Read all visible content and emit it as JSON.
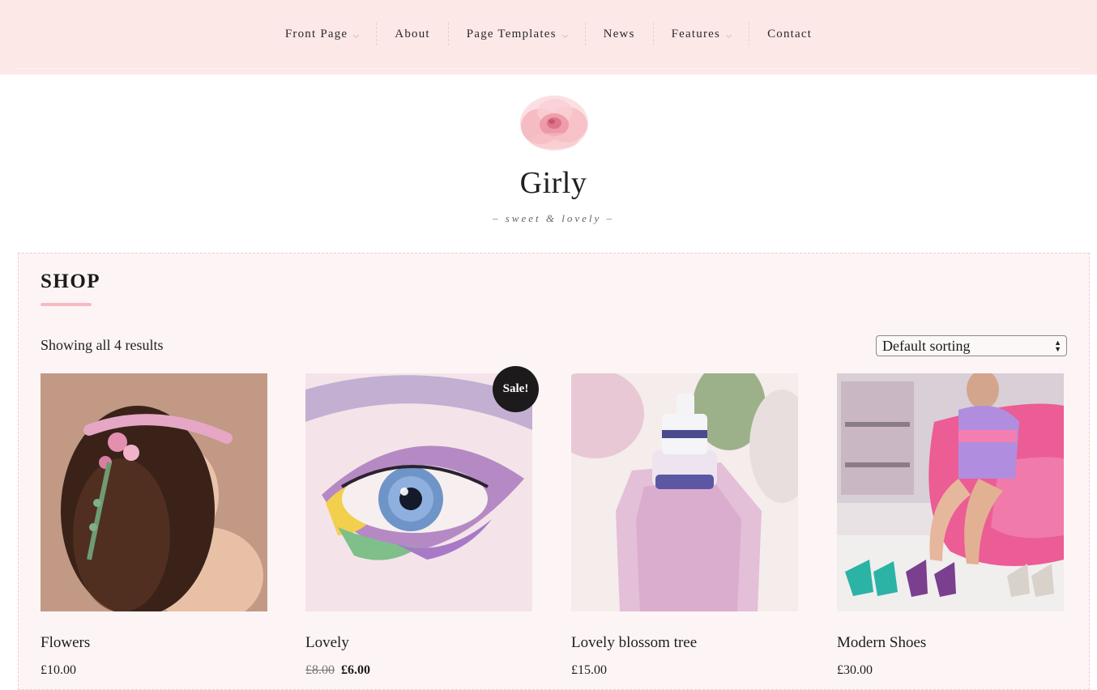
{
  "nav": {
    "items": [
      {
        "label": "Front Page",
        "has_submenu": true
      },
      {
        "label": "About",
        "has_submenu": false
      },
      {
        "label": "Page Templates",
        "has_submenu": true
      },
      {
        "label": "News",
        "has_submenu": false
      },
      {
        "label": "Features",
        "has_submenu": true
      },
      {
        "label": "Contact",
        "has_submenu": false
      }
    ]
  },
  "header": {
    "logo_icon": "rose-logo-icon",
    "title": "Girly",
    "tagline": "– sweet & lovely –"
  },
  "shop": {
    "title": "SHOP",
    "result_count": "Showing all 4 results",
    "sort": {
      "selected": "Default sorting"
    },
    "products": [
      {
        "name": "Flowers",
        "price": "£10.00",
        "on_sale": false
      },
      {
        "name": "Lovely",
        "regular_price": "£8.00",
        "sale_price": "£6.00",
        "on_sale": true,
        "badge": "Sale!"
      },
      {
        "name": "Lovely blossom tree",
        "price": "£15.00",
        "on_sale": false
      },
      {
        "name": "Modern Shoes",
        "price": "£30.00",
        "on_sale": false
      }
    ]
  },
  "colors": {
    "topbar_bg": "#fde8e8",
    "panel_bg": "#fdf5f5",
    "accent_pink": "#f6b9c2",
    "badge_bg": "#1c1a1a"
  }
}
